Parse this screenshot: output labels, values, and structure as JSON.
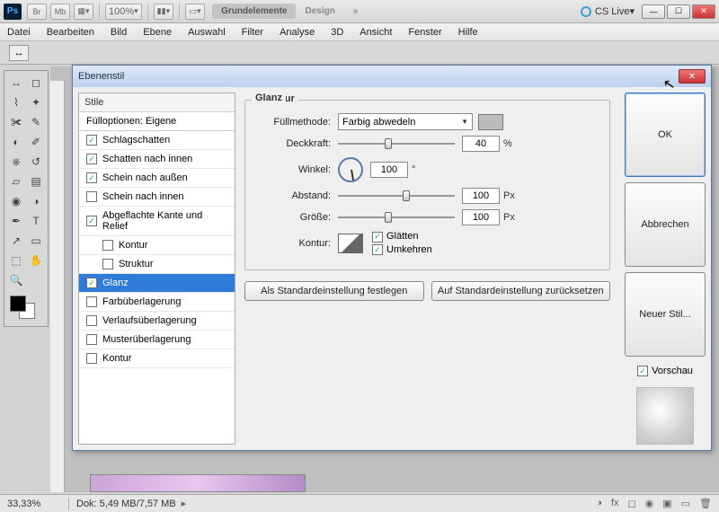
{
  "appbar": {
    "logo": "Ps",
    "small_btns": [
      "Br",
      "Mb"
    ],
    "zoom": "100%",
    "workspace": {
      "active": "Grundelemente",
      "other": "Design",
      "more": "»"
    },
    "cslive": "CS Live"
  },
  "winbuttons": {
    "min": "—",
    "max": "☐",
    "close": "✕"
  },
  "menus": [
    "Datei",
    "Bearbeiten",
    "Bild",
    "Ebene",
    "Auswahl",
    "Filter",
    "Analyse",
    "3D",
    "Ansicht",
    "Fenster",
    "Hilfe"
  ],
  "optbar": {
    "tool": "↔"
  },
  "dialog": {
    "title": "Ebenenstil",
    "styles_header": "Stile",
    "blend_options": "Fülloptionen: Eigene",
    "items": [
      {
        "label": "Schlagschatten",
        "checked": true,
        "indent": false
      },
      {
        "label": "Schatten nach innen",
        "checked": true,
        "indent": false
      },
      {
        "label": "Schein nach außen",
        "checked": true,
        "indent": false
      },
      {
        "label": "Schein nach innen",
        "checked": false,
        "indent": false
      },
      {
        "label": "Abgeflachte Kante und Relief",
        "checked": true,
        "indent": false
      },
      {
        "label": "Kontur",
        "checked": false,
        "indent": true
      },
      {
        "label": "Struktur",
        "checked": false,
        "indent": true
      },
      {
        "label": "Glanz",
        "checked": true,
        "indent": false,
        "selected": true
      },
      {
        "label": "Farbüberlagerung",
        "checked": false,
        "indent": false
      },
      {
        "label": "Verlaufsüberlagerung",
        "checked": false,
        "indent": false
      },
      {
        "label": "Musterüberlagerung",
        "checked": false,
        "indent": false
      },
      {
        "label": "Kontur",
        "checked": false,
        "indent": false
      }
    ],
    "panel_title": "Glanz",
    "section_title": "Struktur",
    "labels": {
      "blendmode": "Füllmethode:",
      "opacity": "Deckkraft:",
      "angle": "Winkel:",
      "distance": "Abstand:",
      "size": "Größe:",
      "contour": "Kontur:"
    },
    "values": {
      "blendmode": "Farbig abwedeln",
      "opacity": "40",
      "opacity_unit": "%",
      "angle": "100",
      "angle_unit": "°",
      "distance": "100",
      "distance_unit": "Px",
      "size": "100",
      "size_unit": "Px"
    },
    "contour_opts": {
      "antialias": "Glätten",
      "invert": "Umkehren"
    },
    "buttons": {
      "default_set": "Als Standardeinstellung festlegen",
      "default_reset": "Auf Standardeinstellung zurücksetzen"
    },
    "right": {
      "ok": "OK",
      "cancel": "Abbrechen",
      "newstyle": "Neuer Stil...",
      "preview": "Vorschau"
    }
  },
  "status": {
    "zoom": "33,33%",
    "doc": "Dok: 5,49 MB/7,57 MB"
  }
}
